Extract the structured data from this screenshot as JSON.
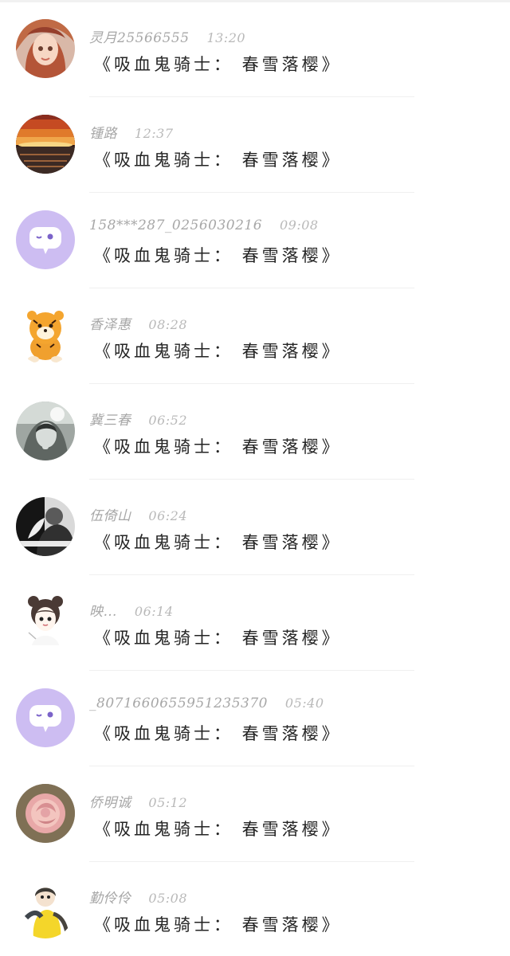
{
  "comments": [
    {
      "name": "灵月25566555",
      "time": "13:20",
      "message": "《吸血鬼骑士： 春雪落樱》",
      "avatar": "anime-girl-avatar"
    },
    {
      "name": "锺路",
      "time": "12:37",
      "message": "《吸血鬼骑士： 春雪落樱》",
      "avatar": "sunset-avatar"
    },
    {
      "name": "158***287_0256030216",
      "time": "09:08",
      "message": "《吸血鬼骑士： 春雪落樱》",
      "avatar": "default-chat-avatar"
    },
    {
      "name": "香泽惠",
      "time": "08:28",
      "message": "《吸血鬼骑士： 春雪落樱》",
      "avatar": "tiger-avatar"
    },
    {
      "name": "冀三春",
      "time": "06:52",
      "message": "《吸血鬼骑士： 春雪落樱》",
      "avatar": "grayscale-photo-avatar"
    },
    {
      "name": "伍倚山",
      "time": "06:24",
      "message": "《吸血鬼骑士： 春雪落樱》",
      "avatar": "couple-avatar"
    },
    {
      "name": "映…",
      "time": "06:14",
      "message": "《吸血鬼骑士： 春雪落樱》",
      "avatar": "chibi-girl-avatar"
    },
    {
      "name": "_8071660655951235370",
      "time": "05:40",
      "message": "《吸血鬼骑士： 春雪落樱》",
      "avatar": "default-chat-avatar"
    },
    {
      "name": "侨明诚",
      "time": "05:12",
      "message": "《吸血鬼骑士： 春雪落樱》",
      "avatar": "rose-avatar"
    },
    {
      "name": "勤伶伶",
      "time": "05:08",
      "message": "《吸血鬼骑士： 春雪落樱》",
      "avatar": "yellow-girl-avatar"
    }
  ],
  "colors": {
    "name_text": "#a7a7a7",
    "time_text": "#b9b9b9",
    "message_text": "#242424",
    "default_avatar": "#cdbdf2",
    "divider": "#f0f0f0"
  }
}
